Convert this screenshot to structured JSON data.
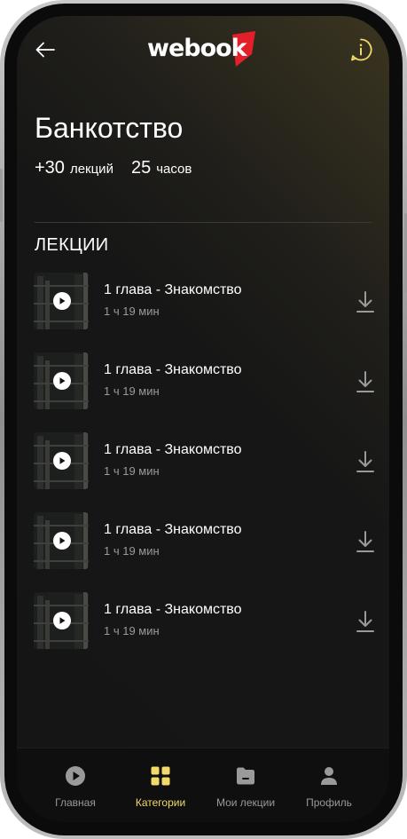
{
  "app": {
    "logo_text": "webook"
  },
  "header": {
    "title": "Банкотство",
    "lectures_count": "+30",
    "lectures_unit": "лекций",
    "hours_count": "25",
    "hours_unit": "часов"
  },
  "section": {
    "title": "ЛЕКЦИИ"
  },
  "lectures": [
    {
      "title": "1 глава - Знакомство",
      "duration": "1 ч 19 мин"
    },
    {
      "title": "1 глава - Знакомство",
      "duration": "1 ч 19 мин"
    },
    {
      "title": "1 глава - Знакомство",
      "duration": "1 ч 19 мин"
    },
    {
      "title": "1 глава - Знакомство",
      "duration": "1 ч 19 мин"
    },
    {
      "title": "1 глава - Знакомство",
      "duration": "1 ч 19 мин"
    }
  ],
  "tabbar": {
    "items": [
      {
        "label": "Главная",
        "icon": "play-circle-icon",
        "active": false
      },
      {
        "label": "Категории",
        "icon": "grid-icon",
        "active": true
      },
      {
        "label": "Мои лекции",
        "icon": "folder-icon",
        "active": false
      },
      {
        "label": "Профиль",
        "icon": "user-icon",
        "active": false
      }
    ]
  },
  "colors": {
    "accent": "#f1d96a",
    "brand_red": "#e3202a",
    "background": "#151515",
    "muted_text": "#9a9a9a"
  }
}
